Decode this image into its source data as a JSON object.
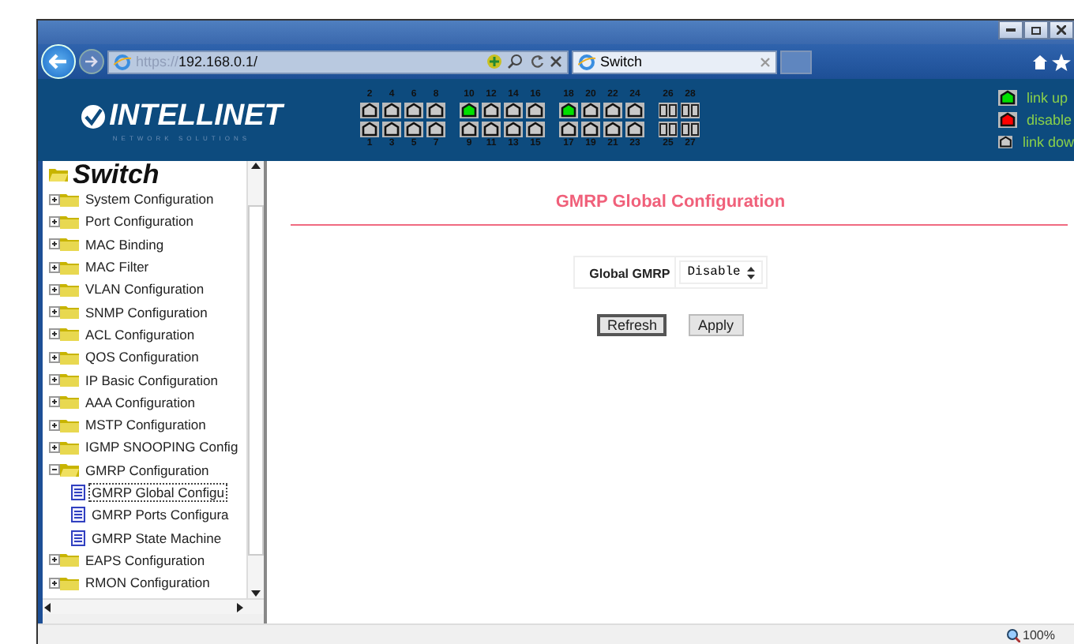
{
  "browser": {
    "address": {
      "scheme": "https://",
      "host": "192.168.0.1/"
    },
    "tabs": [
      {
        "title": "Switch",
        "selected": true
      }
    ]
  },
  "header": {
    "logo": "INTELLINET",
    "tagline": "NETWORK SOLUTIONS",
    "port_groups": [
      {
        "kind": "copper",
        "columns": [
          {
            "top": {
              "label": "2",
              "color": "#c8c8c8"
            },
            "bottom": {
              "label": "1",
              "color": "#c8c8c8"
            }
          },
          {
            "top": {
              "label": "4",
              "color": "#c8c8c8"
            },
            "bottom": {
              "label": "3",
              "color": "#c8c8c8"
            }
          },
          {
            "top": {
              "label": "6",
              "color": "#c8c8c8"
            },
            "bottom": {
              "label": "5",
              "color": "#c8c8c8"
            }
          },
          {
            "top": {
              "label": "8",
              "color": "#c8c8c8"
            },
            "bottom": {
              "label": "7",
              "color": "#c8c8c8"
            }
          }
        ]
      },
      {
        "kind": "copper",
        "columns": [
          {
            "top": {
              "label": "10",
              "color": "#00e000"
            },
            "bottom": {
              "label": "9",
              "color": "#c8c8c8"
            }
          },
          {
            "top": {
              "label": "12",
              "color": "#c8c8c8"
            },
            "bottom": {
              "label": "11",
              "color": "#c8c8c8"
            }
          },
          {
            "top": {
              "label": "14",
              "color": "#c8c8c8"
            },
            "bottom": {
              "label": "13",
              "color": "#c8c8c8"
            }
          },
          {
            "top": {
              "label": "16",
              "color": "#c8c8c8"
            },
            "bottom": {
              "label": "15",
              "color": "#c8c8c8"
            }
          }
        ]
      },
      {
        "kind": "copper",
        "columns": [
          {
            "top": {
              "label": "18",
              "color": "#00e000"
            },
            "bottom": {
              "label": "17",
              "color": "#c8c8c8"
            }
          },
          {
            "top": {
              "label": "20",
              "color": "#c8c8c8"
            },
            "bottom": {
              "label": "19",
              "color": "#c8c8c8"
            }
          },
          {
            "top": {
              "label": "22",
              "color": "#c8c8c8"
            },
            "bottom": {
              "label": "21",
              "color": "#c8c8c8"
            }
          },
          {
            "top": {
              "label": "24",
              "color": "#c8c8c8"
            },
            "bottom": {
              "label": "23",
              "color": "#c8c8c8"
            }
          }
        ]
      },
      {
        "kind": "fiber",
        "columns": [
          {
            "top": {
              "label": "26",
              "color": "#c8c8c8"
            },
            "bottom": {
              "label": "25",
              "color": "#c8c8c8"
            }
          },
          {
            "top": {
              "label": "28",
              "color": "#c8c8c8"
            },
            "bottom": {
              "label": "27",
              "color": "#c8c8c8"
            }
          }
        ]
      }
    ],
    "legend": [
      {
        "label": "link up",
        "color": "#00e000"
      },
      {
        "label": "disable",
        "color": "#ff0000"
      },
      {
        "label": "link dow",
        "color": "#c8c8c8"
      }
    ]
  },
  "sidebar": {
    "title": "Switch",
    "items": [
      {
        "label": "System Configuration",
        "expanded": false
      },
      {
        "label": "Port Configuration",
        "expanded": false
      },
      {
        "label": "MAC Binding",
        "expanded": false
      },
      {
        "label": "MAC Filter",
        "expanded": false
      },
      {
        "label": "VLAN Configuration",
        "expanded": false
      },
      {
        "label": "SNMP Configuration",
        "expanded": false
      },
      {
        "label": "ACL Configuration",
        "expanded": false
      },
      {
        "label": "QOS Configuration",
        "expanded": false
      },
      {
        "label": "IP Basic Configuration",
        "expanded": false
      },
      {
        "label": "AAA Configuration",
        "expanded": false
      },
      {
        "label": "MSTP Configuration",
        "expanded": false
      },
      {
        "label": "IGMP SNOOPING Config",
        "expanded": false
      },
      {
        "label": "GMRP Configuration",
        "expanded": true,
        "children": [
          {
            "label": "GMRP Global Configu",
            "selected": true
          },
          {
            "label": "GMRP Ports Configura",
            "selected": false
          },
          {
            "label": "GMRP State Machine",
            "selected": false
          }
        ]
      },
      {
        "label": "EAPS Configuration",
        "expanded": false
      },
      {
        "label": "RMON Configuration",
        "expanded": false
      }
    ]
  },
  "main": {
    "title": "GMRP Global Configuration",
    "fields": [
      {
        "label": "Global GMRP",
        "value": "Disable"
      }
    ],
    "buttons": [
      {
        "label": "Refresh",
        "default": true
      },
      {
        "label": "Apply",
        "default": false
      }
    ]
  },
  "status_bar": {
    "zoom": "100%"
  }
}
